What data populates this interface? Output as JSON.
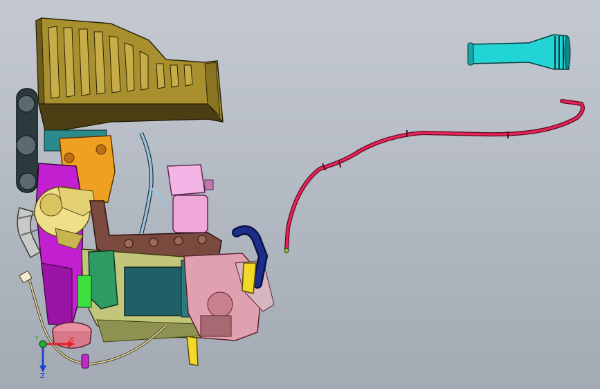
{
  "viewport": {
    "background_top": "#c4c9d1",
    "background_bottom": "#a3aab4"
  },
  "triad": {
    "x_label": "X",
    "y_label": "Y",
    "z_label": "Z",
    "x_color": "#e0202a",
    "y_color": "#20b030",
    "z_color": "#2040d0"
  },
  "parts": {
    "oil_pan_color": "#a8902e",
    "hose_color": "#e6245a",
    "intake_tube_color": "#22d4d6",
    "purple_cover_color": "#c21fd0",
    "manifold_color": "#7a4a3e",
    "teal_block_color": "#1f5f66"
  }
}
